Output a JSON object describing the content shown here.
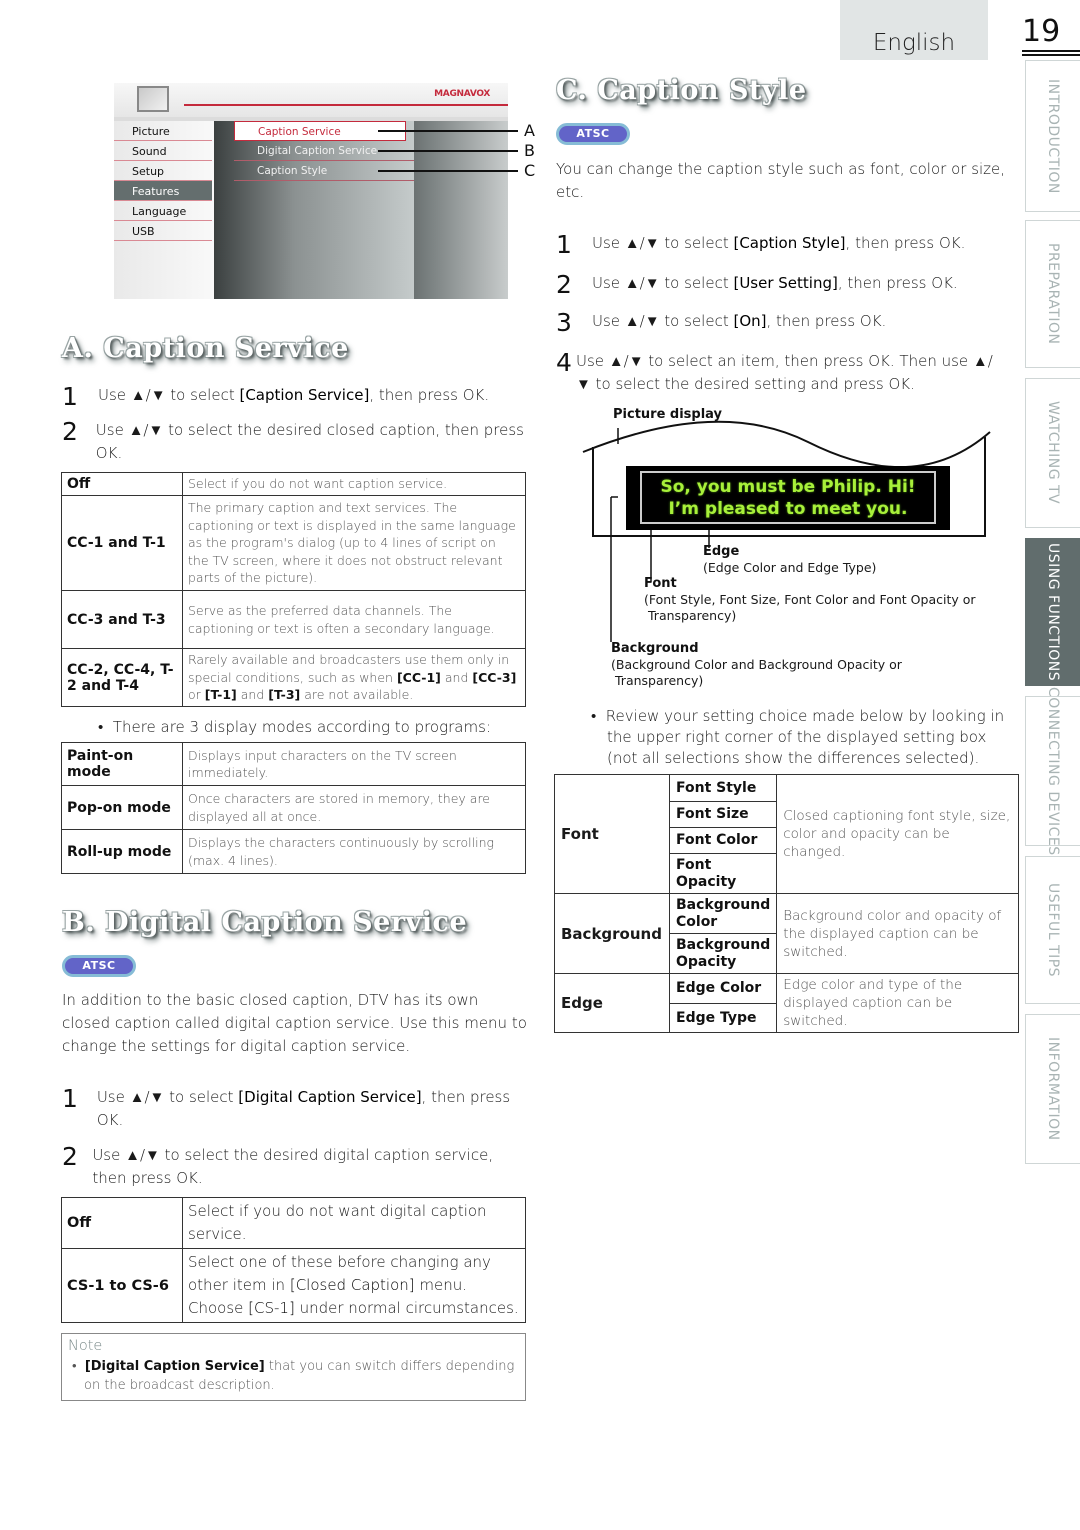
{
  "header": {
    "language": "English",
    "page_number": "19"
  },
  "side_tabs": [
    {
      "label": "INTRODUCTION",
      "active": false
    },
    {
      "label": "PREPARATION",
      "active": false
    },
    {
      "label": "WATCHING TV",
      "active": false
    },
    {
      "label": "USING FUNCTIONS",
      "active": true
    },
    {
      "label": "CONNECTING DEVICES",
      "active": false
    },
    {
      "label": "USEFUL TIPS",
      "active": false
    },
    {
      "label": "INFORMATION",
      "active": false
    }
  ],
  "tv_menu": {
    "brand": "MAGNAVOX",
    "left_items": [
      "Picture",
      "Sound",
      "Setup",
      "Features",
      "Language",
      "USB"
    ],
    "selected_left": "Features",
    "mid_items": [
      "Caption Service",
      "Digital Caption Service",
      "Caption Style"
    ],
    "selected_mid": "Caption Service",
    "callouts": [
      "A",
      "B",
      "C"
    ]
  },
  "section_a": {
    "title": "A.  Caption Service",
    "steps": [
      {
        "num": "1",
        "pre": "Use ▲/▼ to select ",
        "bold": "[Caption Service]",
        "post": ", then press OK."
      },
      {
        "num": "2",
        "pre": "Use ▲/▼ to select the desired closed caption, then press OK.",
        "bold": "",
        "post": ""
      }
    ],
    "table": [
      {
        "key": "Off",
        "value": "Select if you do not want caption service."
      },
      {
        "key": "CC-1 and T-1",
        "value": "The primary caption and text services. The captioning or text is displayed in the same language as the program's dialog (up to 4 lines of script on the TV screen, where it does not obstruct relevant parts of the picture)."
      },
      {
        "key": "CC-3 and T-3",
        "value": "Serve as the preferred data channels. The captioning or text is often a secondary language."
      },
      {
        "key": "CC-2, CC-4, T-2 and T-4",
        "value_parts": [
          "Rarely available and broadcasters use them only in special conditions, such as when ",
          "[CC-1]",
          " and ",
          "[CC-3]",
          " or ",
          "[T-1]",
          " and ",
          "[T-3]",
          " are not available."
        ]
      }
    ],
    "modes_bullet": "There are 3 display modes according to programs:",
    "modes": [
      {
        "key": "Paint-on mode",
        "value": "Displays input characters on the TV screen immediately."
      },
      {
        "key": "Pop-on mode",
        "value": "Once characters are stored in memory, they are displayed all at once."
      },
      {
        "key": "Roll-up mode",
        "value": "Displays the characters continuously by scrolling (max. 4 lines)."
      }
    ]
  },
  "section_b": {
    "title": "B.  Digital Caption Service",
    "badge": "ATSC",
    "intro": "In addition to the basic closed caption, DTV has its own closed caption called digital caption service. Use this menu to change the settings for digital caption service.",
    "steps": [
      {
        "num": "1",
        "pre": "Use ▲/▼ to select ",
        "bold": "[Digital Caption Service]",
        "post": ", then press OK."
      },
      {
        "num": "2",
        "pre": "Use ▲/▼ to select the desired digital caption service, then press OK.",
        "bold": "",
        "post": ""
      }
    ],
    "table": [
      {
        "key": "Off",
        "value": "Select if you do not want digital caption service."
      },
      {
        "key": "CS-1 to CS-6",
        "value_parts": [
          "Select one of these before changing any other item in ",
          "[Closed Caption]",
          " menu. Choose ",
          "[CS-1]",
          " under normal circumstances."
        ]
      }
    ],
    "note": {
      "heading": "Note",
      "bold": "[Digital Caption Service]",
      "text": " that you can switch differs depending on the broadcast description."
    }
  },
  "section_c": {
    "title": "C.  Caption Style",
    "badge": "ATSC",
    "intro": "You can change the caption style such as font, color or size, etc.",
    "steps": [
      {
        "num": "1",
        "pre": "Use ▲/▼ to select ",
        "bold": "[Caption Style]",
        "post": ", then press OK."
      },
      {
        "num": "2",
        "pre": "Use ▲/▼ to select ",
        "bold": "[User Setting]",
        "post": ", then press OK."
      },
      {
        "num": "3",
        "pre": "Use ▲/▼ to select ",
        "bold": "[On]",
        "post": ", then press OK."
      },
      {
        "num": "4",
        "pre": "Use ▲/▼ to select an item, then press OK. Then use ▲/▼ to select the desired setting and press OK.",
        "bold": "",
        "post": ""
      }
    ],
    "diagram": {
      "picture_display": "Picture display",
      "caption_lines": [
        "So, you must be Philip. Hi!",
        "I’m pleased to meet you."
      ],
      "edge_label": "Edge",
      "edge_desc": "(Edge Color and Edge Type)",
      "font_label": "Font",
      "font_desc": [
        "(Font Style, Font Size, Font Color and Font Opacity or",
        "Transparency)"
      ],
      "background_label": "Background",
      "background_desc": [
        "(Background Color and Background Opacity or",
        "Transparency)"
      ]
    },
    "review_bullet": "Review your setting choice made below by looking in the upper right corner of the displayed setting box (not all selections show the differences selected).",
    "style_table": [
      {
        "group": "Font",
        "items": [
          "Font Style",
          "Font Size",
          "Font Color",
          "Font Opacity"
        ],
        "desc": "Closed captioning font style, size, color and opacity can be changed."
      },
      {
        "group": "Background",
        "items": [
          "Background Color",
          "Background Opacity"
        ],
        "desc": "Background color and opacity of the displayed caption can be switched."
      },
      {
        "group": "Edge",
        "items": [
          "Edge Color",
          "Edge Type"
        ],
        "desc": "Edge color and type of the displayed caption can be switched."
      }
    ]
  },
  "colors": {
    "accent_red": "#c42a3c",
    "badge_fill": "#6264c8",
    "badge_border": "#86bcd6",
    "active_tab": "#616d6d",
    "caption_text": "#a8f03a"
  }
}
